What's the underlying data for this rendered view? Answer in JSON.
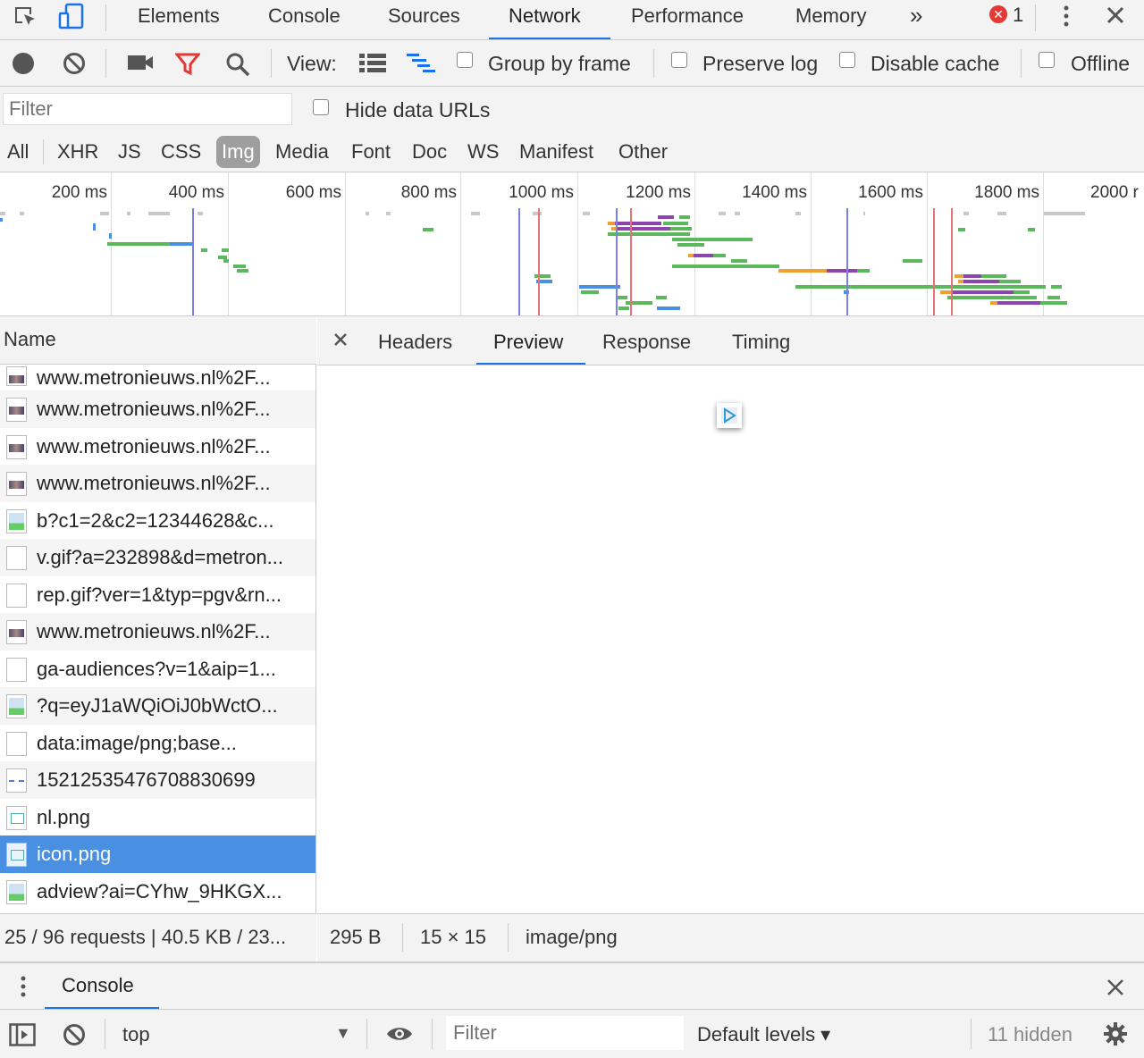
{
  "topbar": {
    "tabs": [
      "Elements",
      "Console",
      "Sources",
      "Network",
      "Performance",
      "Memory"
    ],
    "active_tab": "Network",
    "more_tabs_glyph": "»",
    "error_count": "1"
  },
  "toolbar": {
    "view_label": "View:",
    "group_by_frame": "Group by frame",
    "preserve_log": "Preserve log",
    "disable_cache": "Disable cache",
    "offline": "Offline"
  },
  "filterbar": {
    "filter_placeholder": "Filter",
    "hide_data_urls": "Hide data URLs"
  },
  "type_filters": [
    "All",
    "XHR",
    "JS",
    "CSS",
    "Img",
    "Media",
    "Font",
    "Doc",
    "WS",
    "Manifest",
    "Other"
  ],
  "active_type_filter": "Img",
  "overview": {
    "tick_labels": [
      "200 ms",
      "400 ms",
      "600 ms",
      "800 ms",
      "1000 ms",
      "1200 ms",
      "1400 ms",
      "1600 ms",
      "1800 ms",
      "2000 r"
    ],
    "colors": {
      "green": "#5cb85c",
      "blue": "#4a90e2",
      "purple": "#8e44ad",
      "orange": "#f0a030",
      "grey": "#c8c8c8",
      "dom_line": "#7b7fe8",
      "load_line": "#e57373"
    }
  },
  "name_column": {
    "header": "Name",
    "rows": [
      {
        "name": "www.metronieuws.nl%2F...",
        "icon": "photo-thumb-icon"
      },
      {
        "name": "www.metronieuws.nl%2F...",
        "icon": "photo-thumb-icon"
      },
      {
        "name": "www.metronieuws.nl%2F...",
        "icon": "photo-thumb-icon"
      },
      {
        "name": "www.metronieuws.nl%2F...",
        "icon": "photo-thumb-icon"
      },
      {
        "name": "b?c1=2&c2=12344628&c...",
        "icon": "image-placeholder-icon"
      },
      {
        "name": "v.gif?a=232898&d=metron...",
        "icon": "blank-file-icon"
      },
      {
        "name": "rep.gif?ver=1&typ=pgv&rn...",
        "icon": "blank-file-icon"
      },
      {
        "name": "www.metronieuws.nl%2F...",
        "icon": "photo-thumb-icon"
      },
      {
        "name": "ga-audiences?v=1&aip=1...",
        "icon": "blank-file-icon"
      },
      {
        "name": "?q=eyJ1aWQiOiJ0bWctO...",
        "icon": "image-placeholder-icon"
      },
      {
        "name": "data:image/png;base...",
        "icon": "blank-file-icon"
      },
      {
        "name": "15212535476708830699",
        "icon": "dashed-image-icon"
      },
      {
        "name": "nl.png",
        "icon": "logo-thumb-icon"
      },
      {
        "name": "icon.png",
        "icon": "logo-thumb-icon",
        "selected": true
      },
      {
        "name": "adview?ai=CYhw_9HKGX...",
        "icon": "image-placeholder-icon"
      }
    ],
    "footer": "25 / 96 requests | 40.5 KB / 23..."
  },
  "detail": {
    "tabs": [
      "Headers",
      "Preview",
      "Response",
      "Timing"
    ],
    "active_tab": "Preview",
    "footer": {
      "size": "295 B",
      "dimensions": "15 × 15",
      "mime": "image/png"
    }
  },
  "drawer": {
    "tab": "Console",
    "context": "top",
    "filter_placeholder": "Filter",
    "levels": "Default levels ▾",
    "hidden": "11 hidden"
  }
}
